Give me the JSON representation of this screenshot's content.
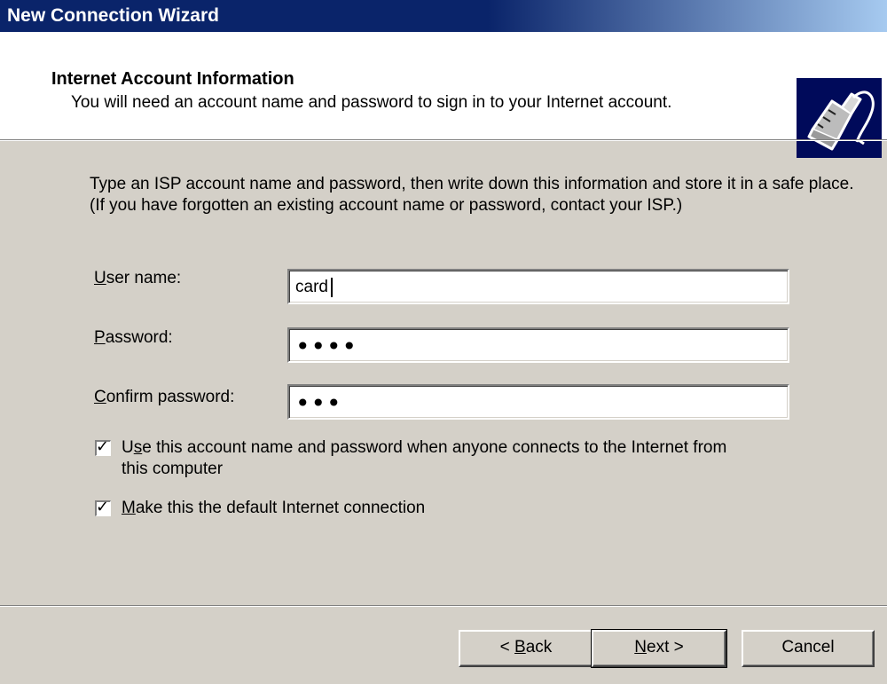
{
  "window": {
    "title": "New Connection Wizard"
  },
  "header": {
    "title": "Internet Account Information",
    "subtitle": "You will need an account name and password to sign in to your Internet account."
  },
  "description": "Type an ISP account name and password, then write down this information and store it in a safe place. (If you have forgotten an existing account name or password, contact your ISP.)",
  "fields": {
    "username": {
      "label_u": "U",
      "label_rest": "ser name:",
      "value": "card"
    },
    "password": {
      "label_u": "P",
      "label_rest": "assword:",
      "value": "••••"
    },
    "confirm": {
      "label_u": "C",
      "label_rest": "onfirm password:",
      "value": "•••"
    }
  },
  "checkboxes": {
    "use_account": {
      "pre": "U",
      "u": "s",
      "rest": "e this account  name and password when anyone connects to the Internet from",
      "line2": "this computer",
      "checked": true
    },
    "default_conn": {
      "u": "M",
      "rest": "ake this the default Internet connection",
      "checked": true
    }
  },
  "buttons": {
    "back": {
      "pre": "< ",
      "u": "B",
      "rest": "ack"
    },
    "next": {
      "u": "N",
      "rest": "ext >"
    },
    "cancel": "Cancel"
  },
  "icons": {
    "logo": "connection-plug-icon",
    "check": "checkmark-icon"
  }
}
